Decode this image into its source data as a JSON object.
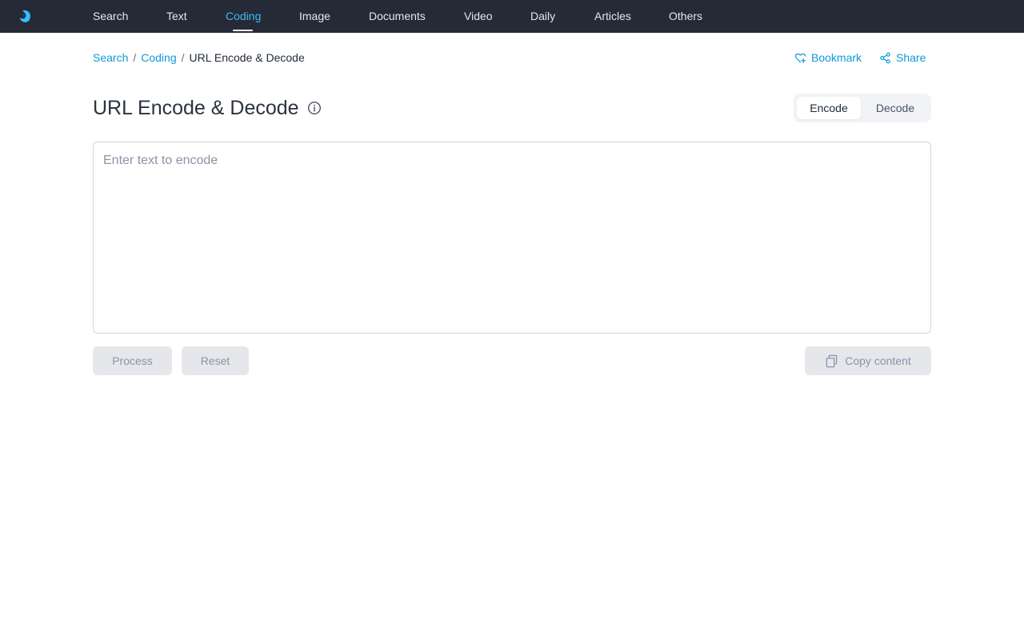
{
  "nav": {
    "logo_icon": "app-logo-icon",
    "items": [
      {
        "label": "Search"
      },
      {
        "label": "Text"
      },
      {
        "label": "Coding",
        "active": true
      },
      {
        "label": "Image"
      },
      {
        "label": "Documents"
      },
      {
        "label": "Video"
      },
      {
        "label": "Daily"
      },
      {
        "label": "Articles"
      },
      {
        "label": "Others"
      }
    ]
  },
  "breadcrumb": {
    "items": [
      "Search",
      "Coding"
    ],
    "separator": "/",
    "current": "URL Encode & Decode"
  },
  "actions": {
    "bookmark": {
      "label": "Bookmark",
      "icon": "heart-plus-icon"
    },
    "share": {
      "label": "Share",
      "icon": "share-icon"
    }
  },
  "page": {
    "title": "URL Encode & Decode",
    "info_icon": "info-icon"
  },
  "mode": {
    "options": [
      "Encode",
      "Decode"
    ],
    "selected": "Encode"
  },
  "input": {
    "value": "",
    "placeholder": "Enter text to encode"
  },
  "buttons": {
    "process": "Process",
    "reset": "Reset",
    "copy": "Copy content",
    "copy_icon": "copy-icon"
  },
  "colors": {
    "nav_bg": "#252a36",
    "accent": "#0e9ad7",
    "nav_active": "#38bdf8",
    "button_bg": "#e5e7eb",
    "button_text": "#8a94a6"
  }
}
